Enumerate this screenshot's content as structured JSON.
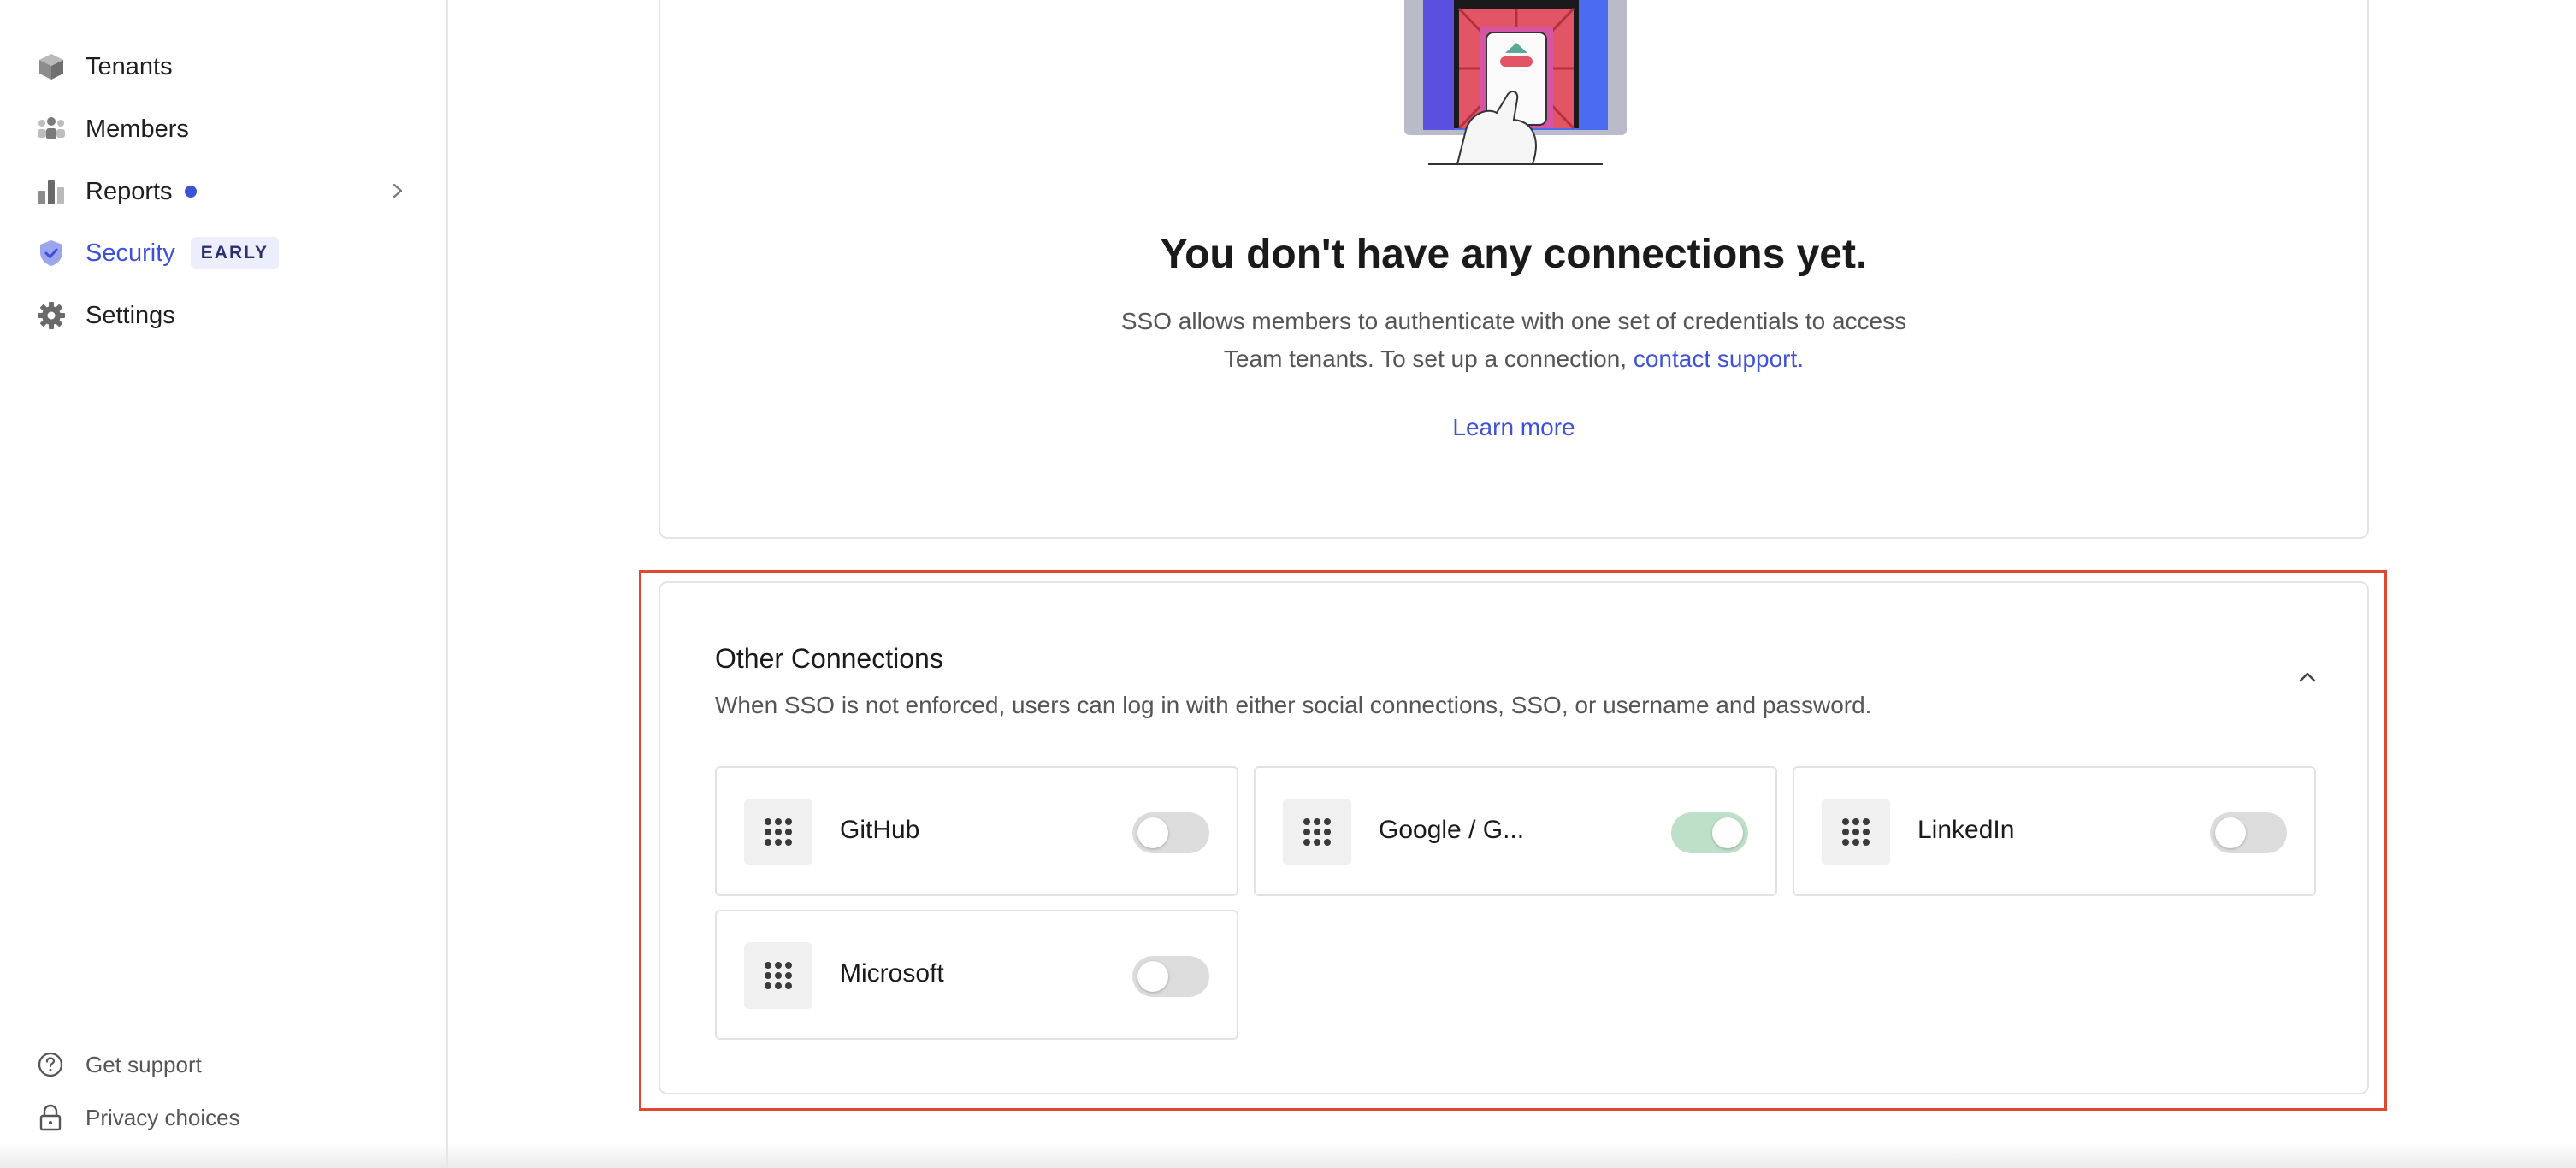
{
  "sidebar": {
    "items": [
      {
        "label": "Tenants",
        "icon": "cube-icon"
      },
      {
        "label": "Members",
        "icon": "members-icon"
      },
      {
        "label": "Reports",
        "icon": "bar-chart-icon"
      },
      {
        "label": "Security",
        "icon": "shield-icon",
        "badge": "EARLY"
      },
      {
        "label": "Settings",
        "icon": "gear-icon"
      }
    ],
    "footer": [
      {
        "label": "Get support",
        "icon": "help-circle-icon"
      },
      {
        "label": "Privacy choices",
        "icon": "lock-icon"
      }
    ]
  },
  "empty_state": {
    "title": "You don't have any connections yet.",
    "desc_line1": "SSO allows members to authenticate with one set of credentials to access",
    "desc_line2": "Team tenants. To set up a connection,",
    "contact_link": "contact support.",
    "learn_more": "Learn more"
  },
  "other_connections": {
    "title": "Other Connections",
    "description": "When SSO is not enforced, users can log in with either social connections, SSO, or username and password.",
    "items": [
      {
        "name": "GitHub",
        "enabled": false
      },
      {
        "name": "Google / G...",
        "enabled": true
      },
      {
        "name": "LinkedIn",
        "enabled": false
      },
      {
        "name": "Microsoft",
        "enabled": false
      }
    ]
  },
  "colors": {
    "accent": "#3f51d8",
    "highlight_border": "#e2472f",
    "toggle_on": "#bfe0c8",
    "toggle_off": "#dcdcdc"
  }
}
